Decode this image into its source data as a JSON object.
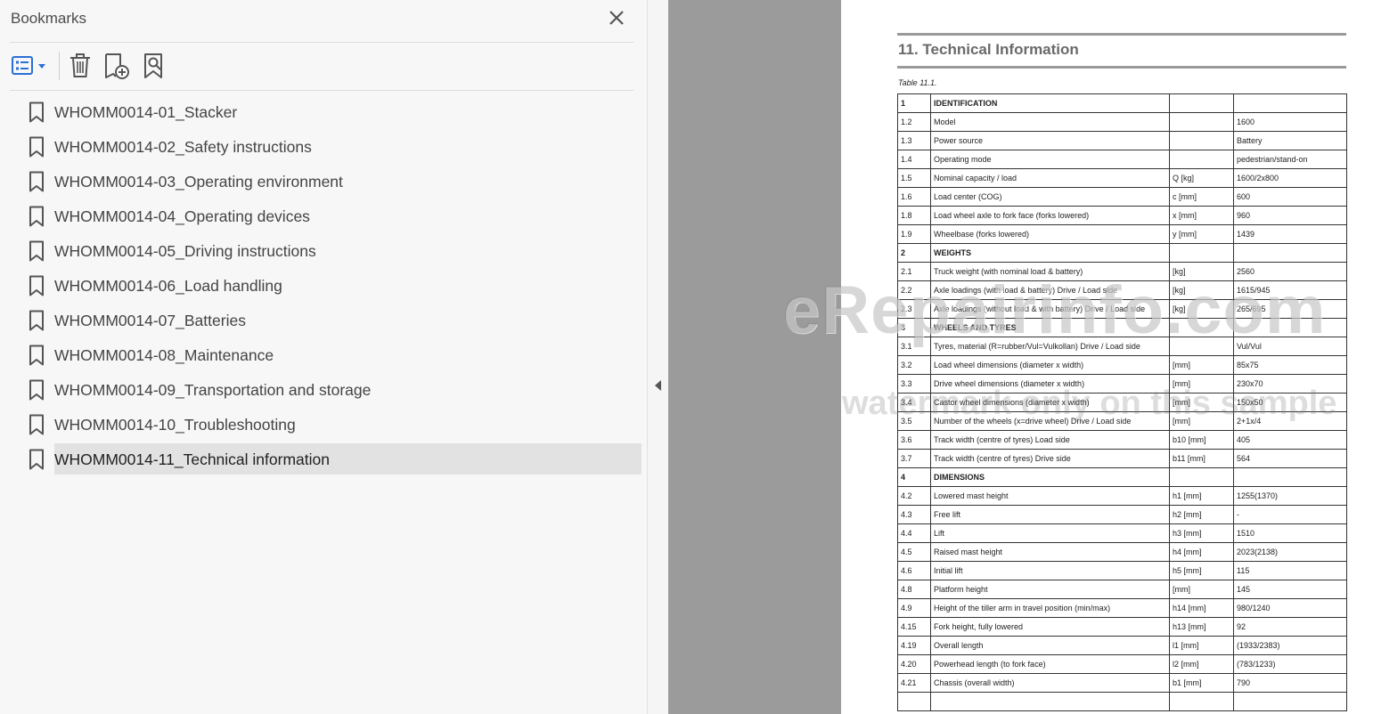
{
  "panel": {
    "title": "Bookmarks",
    "toolbar": {
      "options_icon": "list-options-icon",
      "delete_icon": "trash-icon",
      "new_bookmark_icon": "new-bookmark-icon",
      "expand_bookmark_icon": "bookmark-search-icon"
    },
    "items": [
      {
        "label": "WHOMM0014-01_Stacker"
      },
      {
        "label": "WHOMM0014-02_Safety instructions"
      },
      {
        "label": "WHOMM0014-03_Operating environment"
      },
      {
        "label": "WHOMM0014-04_Operating devices"
      },
      {
        "label": "WHOMM0014-05_Driving instructions"
      },
      {
        "label": "WHOMM0014-06_Load handling"
      },
      {
        "label": "WHOMM0014-07_Batteries"
      },
      {
        "label": "WHOMM0014-08_Maintenance"
      },
      {
        "label": "WHOMM0014-09_Transportation and storage"
      },
      {
        "label": "WHOMM0014-10_Troubleshooting"
      },
      {
        "label": "WHOMM0014-11_Technical information",
        "selected": true
      }
    ]
  },
  "document": {
    "heading": "11. Technical Information",
    "caption": "Table 11.1.",
    "rows": [
      [
        "1",
        "IDENTIFICATION",
        "",
        ""
      ],
      [
        "1.2",
        "Model",
        "",
        "1600"
      ],
      [
        "1.3",
        "Power source",
        "",
        "Battery"
      ],
      [
        "1.4",
        "Operating mode",
        "",
        "pedestrian/stand-on"
      ],
      [
        "1.5",
        "Nominal capacity / load",
        "Q [kg]",
        "1600/2x800"
      ],
      [
        "1.6",
        "Load center (COG)",
        "c [mm]",
        "600"
      ],
      [
        "1.8",
        "Load wheel axle to fork face (forks lowered)",
        "x [mm]",
        "960"
      ],
      [
        "1.9",
        "Wheelbase (forks lowered)",
        "y [mm]",
        "1439"
      ],
      [
        "2",
        "WEIGHTS",
        "",
        ""
      ],
      [
        "2.1",
        "Truck weight (with nominal load & battery)",
        "[kg]",
        "2560"
      ],
      [
        "2.2",
        "Axle loadings (with load & battery) Drive / Load side",
        "[kg]",
        "1615/945"
      ],
      [
        "2.3",
        "Axle loadings (without load & with battery) Drive / Load side",
        "[kg]",
        "265/695"
      ],
      [
        "3",
        "WHEELS AND TYRES",
        "",
        ""
      ],
      [
        "3.1",
        "Tyres, material (R=rubber/Vul=Vulkollan) Drive / Load side",
        "",
        "Vul/Vul"
      ],
      [
        "3.2",
        "Load wheel dimensions (diameter x width)",
        "[mm]",
        "85x75"
      ],
      [
        "3.3",
        "Drive wheel dimensions (diameter x width)",
        "[mm]",
        "230x70"
      ],
      [
        "3.4",
        "Castor wheel dimensions (diameter x width)",
        "[mm]",
        "150x50"
      ],
      [
        "3.5",
        "Number of the wheels (x=drive wheel) Drive / Load side",
        "[mm]",
        "2+1x/4"
      ],
      [
        "3.6",
        "Track width (centre of tyres) Load side",
        "b10 [mm]",
        "405"
      ],
      [
        "3.7",
        "Track width (centre of tyres) Drive side",
        "b11 [mm]",
        "564"
      ],
      [
        "4",
        "DIMENSIONS",
        "",
        ""
      ],
      [
        "4.2",
        "Lowered mast height",
        "h1 [mm]",
        "1255(1370)"
      ],
      [
        "4.3",
        "Free lift",
        "h2 [mm]",
        "-"
      ],
      [
        "4.4",
        "Lift",
        "h3 [mm]",
        "1510"
      ],
      [
        "4.5",
        "Raised mast height",
        "h4 [mm]",
        "2023(2138)"
      ],
      [
        "4.6",
        "Initial lift",
        "h5 [mm]",
        "115"
      ],
      [
        "4.8",
        "Platform height",
        "[mm]",
        "145"
      ],
      [
        "4.9",
        "Height of the tiller arm in travel position (min/max)",
        "h14 [mm]",
        "980/1240"
      ],
      [
        "4.15",
        "Fork height, fully lowered",
        "h13 [mm]",
        "92"
      ],
      [
        "4.19",
        "Overall length",
        "l1 [mm]",
        "(1933/2383)"
      ],
      [
        "4.20",
        "Powerhead length (to fork face)",
        "l2 [mm]",
        "(783/1233)"
      ],
      [
        "4.21",
        "Chassis (overall width)",
        "b1 [mm]",
        "790"
      ],
      [
        "",
        "",
        "",
        ""
      ]
    ],
    "section_rows": [
      0,
      8,
      12,
      20
    ]
  },
  "watermark": {
    "line1": "eRepairinfo.com",
    "line2": "watermark only on this sample"
  }
}
